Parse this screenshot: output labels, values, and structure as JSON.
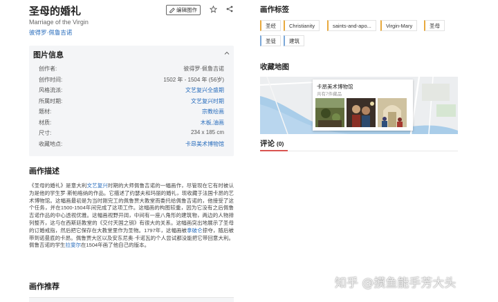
{
  "artwork": {
    "title": "圣母的婚礼",
    "subtitle": "Marriage of the Virgin",
    "artist": "彼得罗·佩鲁吉诺",
    "edit_label": "编辑图作"
  },
  "info": {
    "heading": "图片信息",
    "rows": [
      {
        "key": "创作者:",
        "value": "彼得罗·佩鲁吉诺"
      },
      {
        "key": "创作时间:",
        "value": "1502 年 - 1504 年  (56岁)"
      },
      {
        "key": "风格流派:",
        "value": "文艺复兴全盛期"
      },
      {
        "key": "所属时期:",
        "value": "文艺复兴时期"
      },
      {
        "key": "题材:",
        "value": "宗教绘画"
      },
      {
        "key": "材质:",
        "value": "木板,油画"
      },
      {
        "key": "尺寸:",
        "value": "234 x 185 cm"
      },
      {
        "key": "收藏地点:",
        "value": "卡昂美术博物馆"
      }
    ]
  },
  "description": {
    "heading": "画作描述",
    "p1": "《圣母的婚礼》是意大利",
    "p1_link": "文艺复兴",
    "p2": "时期的大师佩鲁吉诺的一幅画作，尽管现在它有时被认为是他的学生罗·斯帕格纳的作品。它描述了约瑟夫和玛丽的婚礼，现收藏于法国卡昂的艺术博物馆。这幅画最初是为当时刚完工的佩鲁贾大教堂而委托给佩鲁吉诺的，他接受了这个任务，并在1500-1504年间完成了这项工作。这幅画的构图较重，因为它没有之后佩鲁吉诺作品的中心透视优雅。这幅画视野开阔，中间有一座八角形的建筑物，两边的人物排列整齐，这与在西斯廷教堂的《交付天国之钥》有很大的关系。这幅画突出地展示了圣母的订婚戒指，然后把它保存在大教堂里作为圣物。1797年，这幅画被",
    "p2_link": "拿破仑",
    "p3": "掠夺，随后被带到诺曼底的卡昂。佩鲁贾大区以及安东尼奥·卡诺瓦的个人尝试都没能把它带回意大利。佩鲁吉诺的学生",
    "p3_link": "拉斐尔",
    "p4": "在1504年画了他自己的版本。"
  },
  "recommend": {
    "heading": "画作推荐"
  },
  "tags": {
    "heading": "画作标签",
    "items": [
      "圣经",
      "Christianity",
      "saints-and-apo...",
      "Virgin-Mary",
      "圣母",
      "圣徒",
      "建筑"
    ]
  },
  "map": {
    "heading": "收藏地图",
    "museum": "卡昂美术博物馆",
    "count_text": "共有7件藏品"
  },
  "comments": {
    "label": "评论",
    "count": "(0)"
  },
  "watermark": "知乎 @摸鱼能手芳大头",
  "colors": {
    "link": "#2a6ebd",
    "tag_orange": "#e8a93c",
    "tag_blue": "#7aa7d8",
    "accent_red": "#d9534f"
  }
}
